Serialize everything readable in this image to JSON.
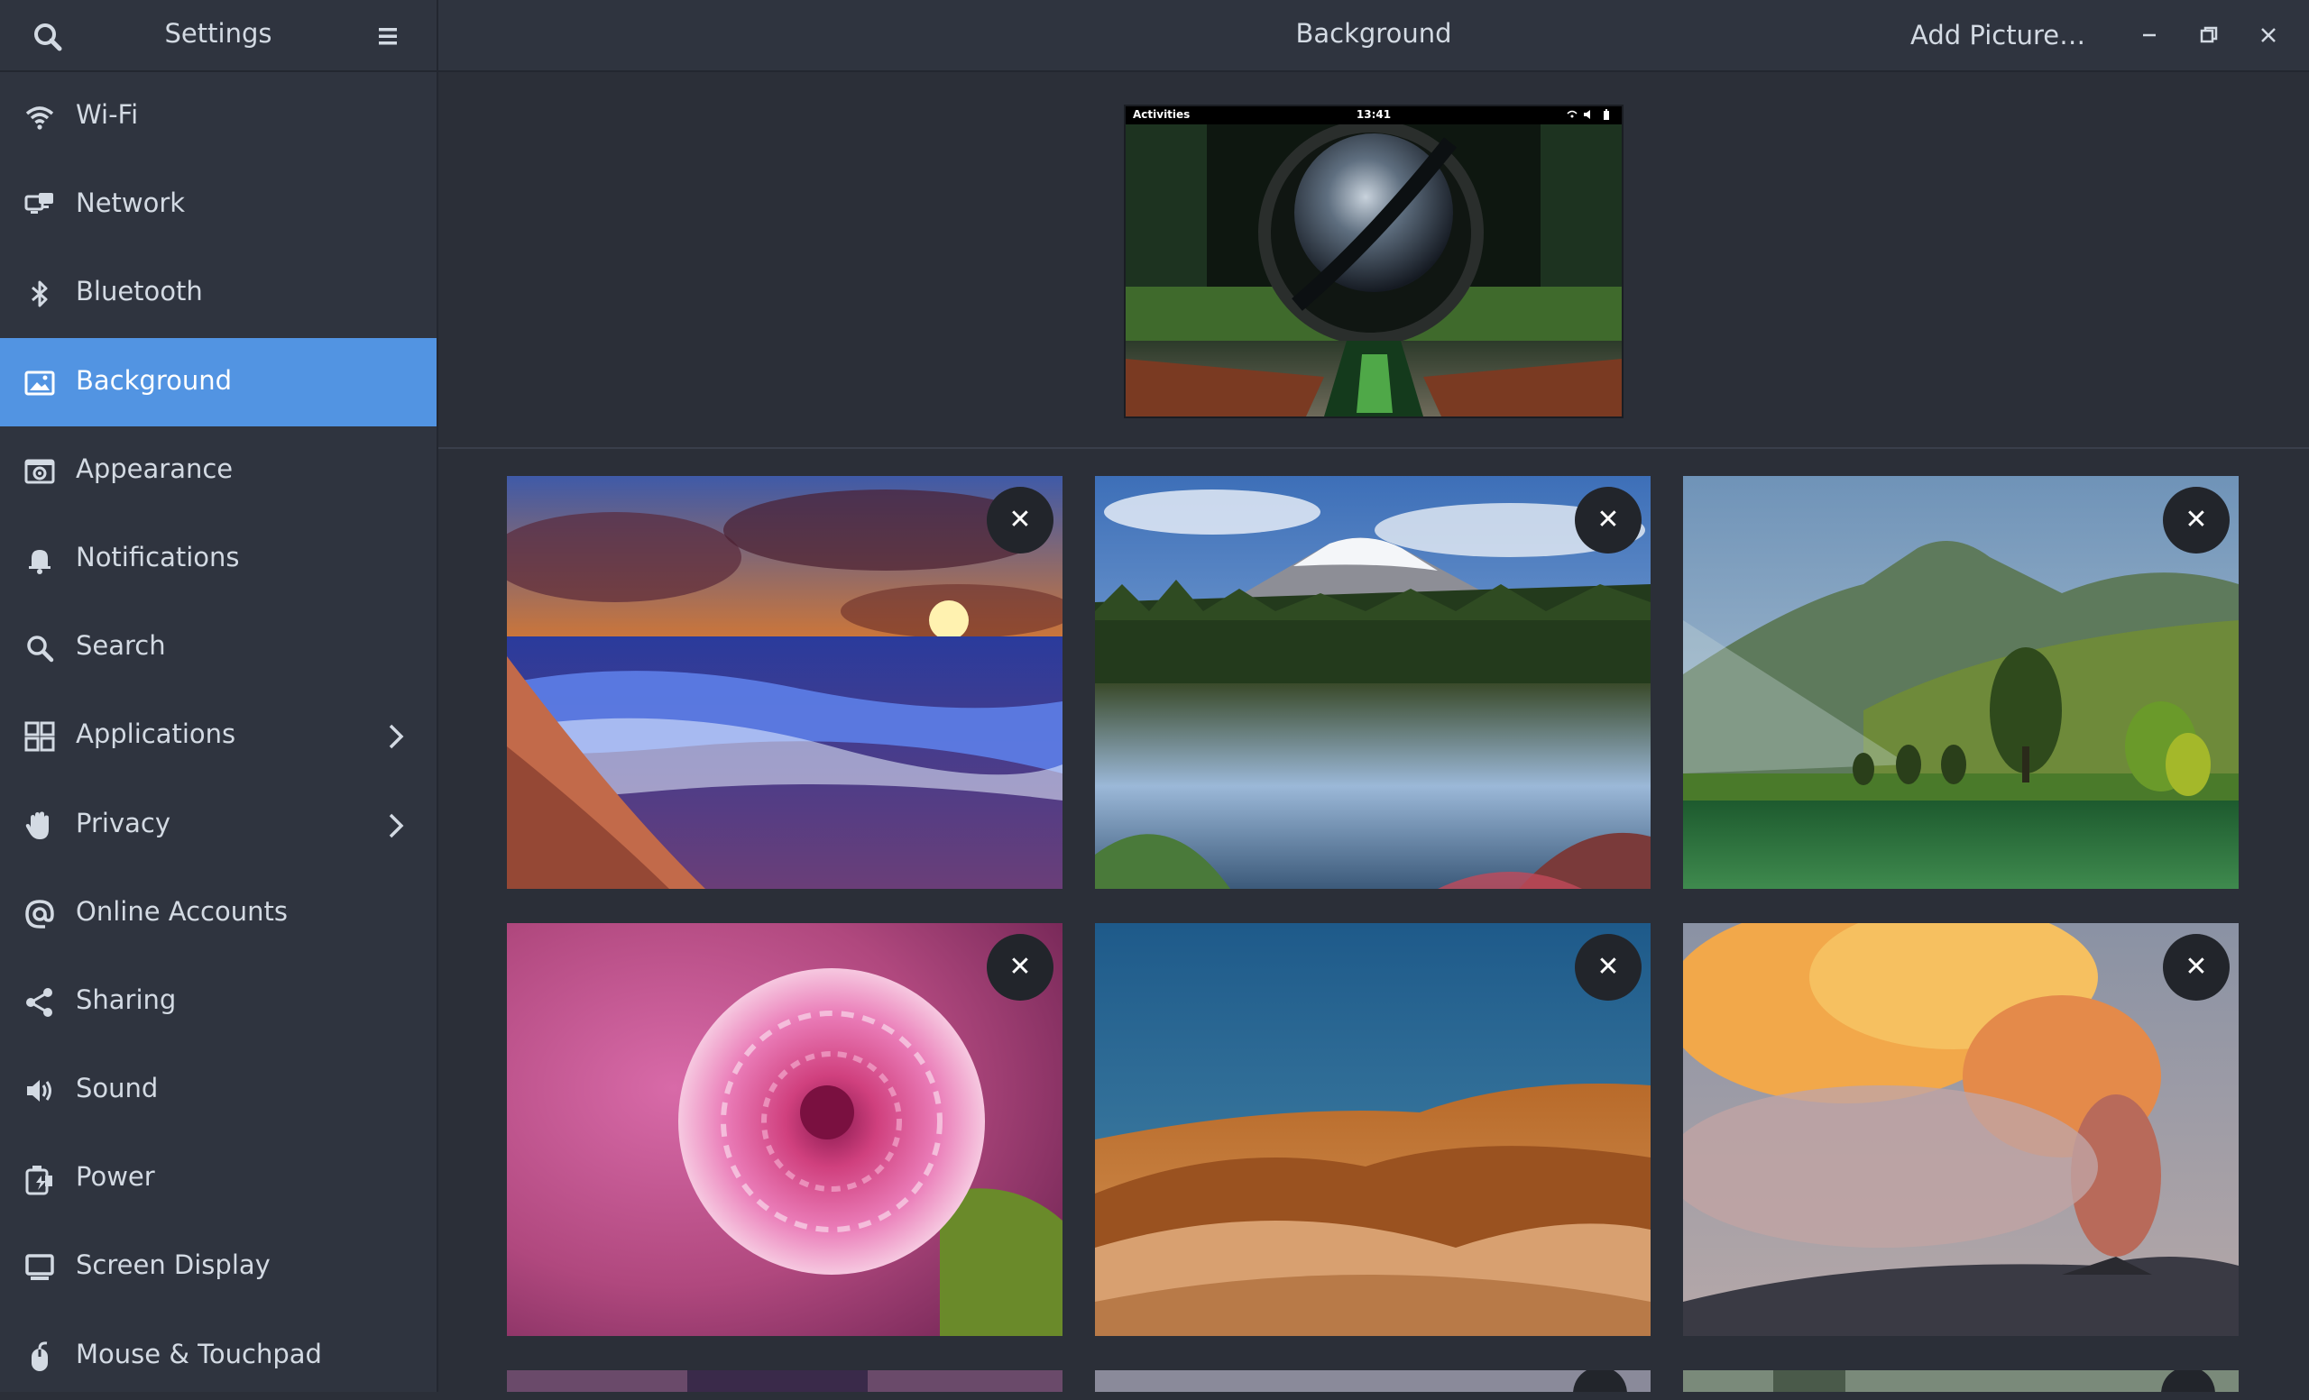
{
  "sidebar": {
    "title": "Settings",
    "items": [
      {
        "label": "Wi-Fi",
        "icon": "wifi-icon"
      },
      {
        "label": "Network",
        "icon": "network-icon"
      },
      {
        "label": "Bluetooth",
        "icon": "bluetooth-icon"
      },
      {
        "label": "Background",
        "icon": "background-icon",
        "active": true
      },
      {
        "label": "Appearance",
        "icon": "appearance-icon"
      },
      {
        "label": "Notifications",
        "icon": "bell-icon"
      },
      {
        "label": "Search",
        "icon": "search-icon"
      },
      {
        "label": "Applications",
        "icon": "apps-grid-icon",
        "has_submenu": true
      },
      {
        "label": "Privacy",
        "icon": "hand-icon",
        "has_submenu": true
      },
      {
        "label": "Online Accounts",
        "icon": "at-icon"
      },
      {
        "label": "Sharing",
        "icon": "share-icon"
      },
      {
        "label": "Sound",
        "icon": "speaker-icon"
      },
      {
        "label": "Power",
        "icon": "power-icon"
      },
      {
        "label": "Screen Display",
        "icon": "display-icon"
      },
      {
        "label": "Mouse & Touchpad",
        "icon": "mouse-icon"
      }
    ]
  },
  "header": {
    "title": "Background",
    "add_label": "Add Picture…"
  },
  "preview": {
    "activities": "Activities",
    "clock": "13:41"
  },
  "colors": {
    "accent": "#5294e2",
    "sidebar_bg": "#2f343f",
    "content_bg": "#2b2f38"
  }
}
